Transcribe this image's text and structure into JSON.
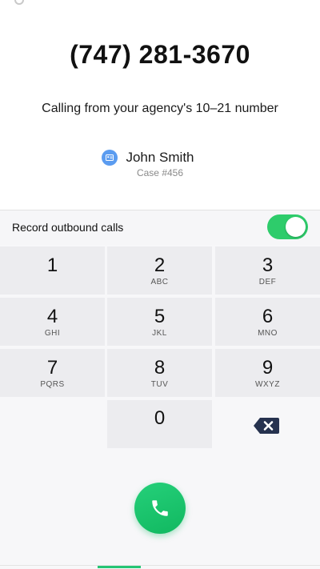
{
  "call": {
    "phone_number": "(747) 281-3670",
    "calling_from": "Calling from your agency's 10–21 number"
  },
  "contact": {
    "name": "John Smith",
    "case": "Case #456",
    "icon": "contact-card-icon",
    "icon_color": "#5b9cf0"
  },
  "record": {
    "label": "Record outbound calls",
    "enabled": true,
    "toggle_color": "#2ecc6b"
  },
  "keypad": {
    "keys": [
      {
        "digit": "1",
        "letters": ""
      },
      {
        "digit": "2",
        "letters": "ABC"
      },
      {
        "digit": "3",
        "letters": "DEF"
      },
      {
        "digit": "4",
        "letters": "GHI"
      },
      {
        "digit": "5",
        "letters": "JKL"
      },
      {
        "digit": "6",
        "letters": "MNO"
      },
      {
        "digit": "7",
        "letters": "PQRS"
      },
      {
        "digit": "8",
        "letters": "TUV"
      },
      {
        "digit": "9",
        "letters": "WXYZ"
      },
      {
        "digit": "0",
        "letters": ""
      }
    ],
    "backspace_icon": "backspace-icon"
  },
  "call_button": {
    "icon": "phone-icon",
    "color": "#1ec46f"
  }
}
